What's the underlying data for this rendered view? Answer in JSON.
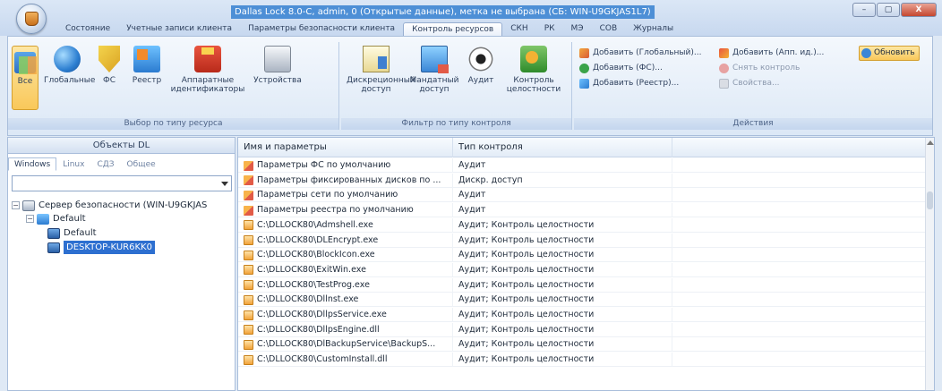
{
  "window": {
    "title": "Dallas Lock 8.0-C, admin, 0 (Открытые данные), метка не выбрана (СБ: WIN-U9GKJAS1L7)",
    "controls": [
      "–",
      "▢",
      "X"
    ]
  },
  "tabs": [
    {
      "label": "Состояние"
    },
    {
      "label": "Учетные записи клиента"
    },
    {
      "label": "Параметры безопасности клиента"
    },
    {
      "label": "Контроль ресурсов"
    },
    {
      "label": "СКН"
    },
    {
      "label": "РК"
    },
    {
      "label": "МЭ"
    },
    {
      "label": "СОВ"
    },
    {
      "label": "Журналы"
    }
  ],
  "ribbon": {
    "group1": {
      "label": "Выбор по типу ресурса",
      "buttons": [
        "Все",
        "Глобальные",
        "ФС",
        "Реестр",
        "Аппаратные идентификаторы",
        "Устройства"
      ]
    },
    "group2": {
      "label": "Фильтр по типу контроля",
      "buttons": [
        "Дискреционный доступ",
        "Мандатный доступ",
        "Аудит",
        "Контроль целостности"
      ]
    },
    "group3": {
      "label": "Действия",
      "col1": [
        "Добавить (Глобальный)...",
        "Добавить (ФС)...",
        "Добавить (Реестр)..."
      ],
      "col2": [
        "Добавить (Апп. ид.)...",
        "Снять контроль",
        "Свойства..."
      ],
      "refresh": "Обновить"
    }
  },
  "left_panel": {
    "title": "Объекты DL",
    "subtabs": [
      "Windows",
      "Linux",
      "СДЗ",
      "Общее"
    ],
    "combo_value": "",
    "tree": [
      {
        "label": "Сервер безопасности (WIN-U9GKJAS",
        "expander": "−"
      },
      {
        "label": "Default",
        "expander": "−"
      },
      {
        "label": "Default"
      },
      {
        "label": "DESKTOP-KUR6KK0"
      }
    ]
  },
  "grid": {
    "columns": [
      "Имя и параметры",
      "Тип контроля"
    ],
    "rows": [
      {
        "name": "Параметры ФС по умолчанию",
        "type": "Аудит",
        "icon": "param"
      },
      {
        "name": "Параметры фиксированных дисков по ...",
        "type": "Дискр. доступ",
        "icon": "param"
      },
      {
        "name": "Параметры сети по умолчанию",
        "type": "Аудит",
        "icon": "param"
      },
      {
        "name": "Параметры реестра по умолчанию",
        "type": "Аудит",
        "icon": "param"
      },
      {
        "name": "C:\\DLLOCK80\\Admshell.exe",
        "type": "Аудит; Контроль целостности",
        "icon": "file"
      },
      {
        "name": "C:\\DLLOCK80\\DLEncrypt.exe",
        "type": "Аудит; Контроль целостности",
        "icon": "file"
      },
      {
        "name": "C:\\DLLOCK80\\BlockIcon.exe",
        "type": "Аудит; Контроль целостности",
        "icon": "file"
      },
      {
        "name": "C:\\DLLOCK80\\ExitWin.exe",
        "type": "Аудит; Контроль целостности",
        "icon": "file"
      },
      {
        "name": "C:\\DLLOCK80\\TestProg.exe",
        "type": "Аудит; Контроль целостности",
        "icon": "file"
      },
      {
        "name": "C:\\DLLOCK80\\Dllnst.exe",
        "type": "Аудит; Контроль целостности",
        "icon": "file"
      },
      {
        "name": "C:\\DLLOCK80\\DllpsService.exe",
        "type": "Аудит; Контроль целостности",
        "icon": "file"
      },
      {
        "name": "C:\\DLLOCK80\\DllpsEngine.dll",
        "type": "Аудит; Контроль целостности",
        "icon": "file"
      },
      {
        "name": "C:\\DLLOCK80\\DlBackupService\\BackupS...",
        "type": "Аудит; Контроль целостности",
        "icon": "file"
      },
      {
        "name": "C:\\DLLOCK80\\CustomInstall.dll",
        "type": "Аудит; Контроль целостности",
        "icon": "file"
      }
    ]
  }
}
